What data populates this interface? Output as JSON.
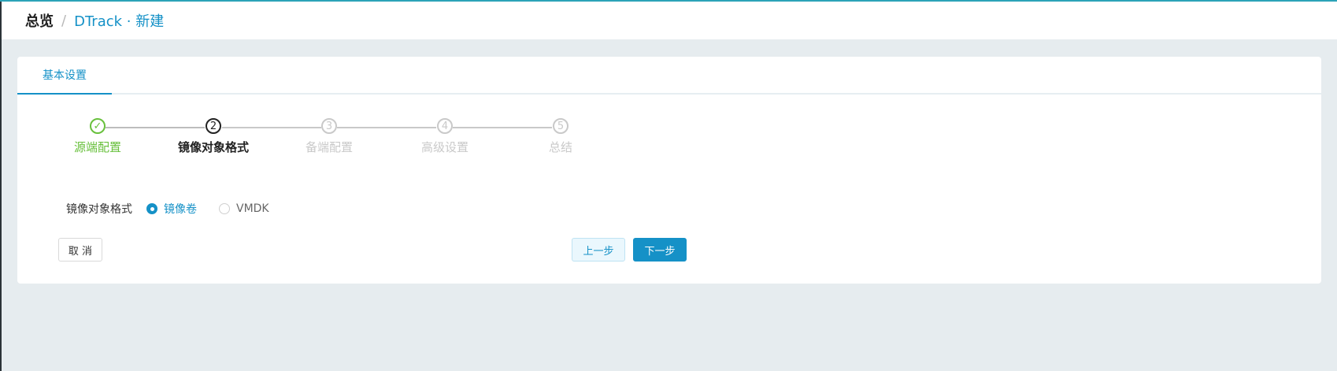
{
  "header": {
    "breadcrumb_root": "总览",
    "separator": "/",
    "breadcrumb_current": "DTrack · 新建"
  },
  "tabs": [
    {
      "label": "基本设置",
      "active": true
    }
  ],
  "steps": [
    {
      "number": "✓",
      "label": "源端配置",
      "status": "done"
    },
    {
      "number": "2",
      "label": "镜像对象格式",
      "status": "active"
    },
    {
      "number": "3",
      "label": "备端配置",
      "status": "pending"
    },
    {
      "number": "4",
      "label": "高级设置",
      "status": "pending"
    },
    {
      "number": "5",
      "label": "总结",
      "status": "pending"
    }
  ],
  "form": {
    "label": "镜像对象格式",
    "options": [
      {
        "label": "镜像卷",
        "checked": true
      },
      {
        "label": "VMDK",
        "checked": false
      }
    ]
  },
  "buttons": {
    "cancel": "取 消",
    "prev": "上一步",
    "next": "下一步"
  },
  "colors": {
    "accent": "#1591c7",
    "success": "#68c03c",
    "background": "#e6ecef"
  }
}
